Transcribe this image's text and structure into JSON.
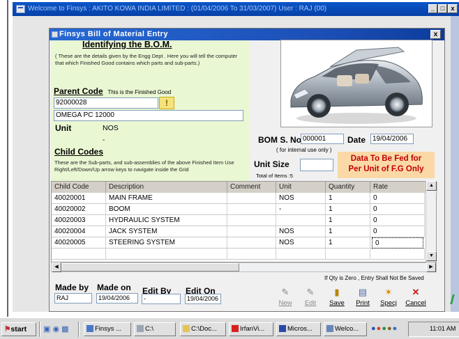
{
  "outer_window": {
    "title": "Welcome to Finsys : AKITO KOWA INDIA LIMITED : (01/04/2006 To 31/03/2007) User : RAJ (00)",
    "controls": [
      "_",
      "□",
      "x"
    ]
  },
  "dialog": {
    "title": "Finsys Bill of Material Entry",
    "close_label": "x",
    "heading": "Identifying the B.O.M.",
    "intro_note": "( These are the details given by the Engg Dept . Here you will tell the computer that which Finished Good contains which parts and sub-parts.)",
    "parent_code_label": "Parent Code",
    "parent_code_hint": "This is the Finished Good",
    "parent_code_value": "92000028",
    "warn_symbol": "!",
    "parent_desc_value": "OMEGA PC 12000",
    "unit_label": "Unit",
    "unit_value": "NOS",
    "dash": "-",
    "child_codes_label": "Child Codes",
    "child_codes_note": "These are the Sub-parts, and sub-assemblies of the above Finished Item Use Right/Left/Down/Up arrow keys to navigate inside the Grid",
    "bom_no_label": "BOM S. No.",
    "bom_no_value": "000001",
    "bom_no_note": "( for internal use only )",
    "date_label": "Date",
    "date_value": "19/04/2006",
    "unit_size_label": "Unit Size",
    "unit_size_value": "",
    "total_items": "Total of Items :5",
    "orange_line1": "Data To Be Fed for",
    "orange_line2": "Per Unit of F.G Only"
  },
  "grid": {
    "columns": [
      "Child Code",
      "Description",
      "Comment",
      "Unit",
      "Quantity",
      "Rate"
    ],
    "rows": [
      [
        "40020001",
        "MAIN FRAME",
        "",
        "NOS",
        "1",
        "0"
      ],
      [
        "40020002",
        "BOOM",
        "",
        "-",
        "1",
        "0"
      ],
      [
        "40020003",
        "HYDRAULIC SYSTEM",
        "",
        "",
        "1",
        "0"
      ],
      [
        "40020004",
        "JACK SYSTEM",
        "",
        "NOS",
        "1",
        "0"
      ],
      [
        "40020005",
        "STEERING SYSTEM",
        "",
        "NOS",
        "1",
        "0"
      ],
      [
        "",
        "",
        "",
        "",
        "",
        ""
      ]
    ]
  },
  "footer": {
    "made_by_label": "Made by",
    "made_by_value": "RAJ",
    "made_on_label": "Made on",
    "made_on_value": "19/04/2006",
    "edit_by_label": "Edit By",
    "edit_by_value": "-",
    "edit_on_label": "Edit On",
    "edit_on_value": "19/04/2006",
    "qty_note": "If Qty is Zero , Entry Shall Not Be Saved",
    "buttons": [
      {
        "label": "New",
        "icon": "new-icon",
        "enabled": false
      },
      {
        "label": "Edit",
        "icon": "edit-icon",
        "enabled": false
      },
      {
        "label": "Save",
        "icon": "save-icon",
        "enabled": true
      },
      {
        "label": "Print",
        "icon": "print-icon",
        "enabled": true
      },
      {
        "label": "Specj",
        "icon": "spec-icon",
        "enabled": true
      },
      {
        "label": "Cancel",
        "icon": "cancel-icon",
        "enabled": true
      }
    ]
  },
  "taskbar": {
    "start_label": "start",
    "items": [
      "Finsys ...",
      "C:\\",
      "C:\\Doc...",
      "IrfanVi...",
      "Micros...",
      "Welco..."
    ],
    "clock": "11:01 AM"
  },
  "colors": {
    "titlebar": "#0a56c8",
    "green_panel": "#eaf7d3",
    "orange_box": "#fbd9a6",
    "orange_text": "#c10000"
  }
}
